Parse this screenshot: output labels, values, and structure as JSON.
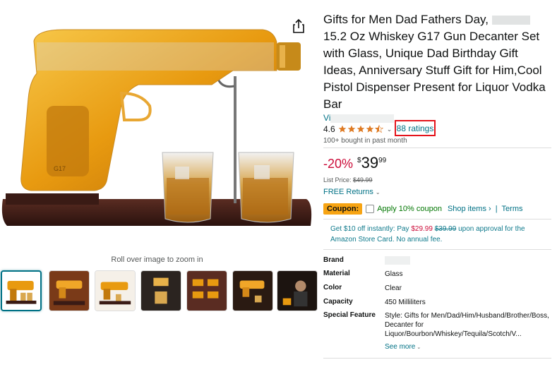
{
  "product": {
    "title": "Gifts for Men Dad Fathers Day, 15.2 Oz Whiskey G17 Gun Decanter Set with Glass, Unique Dad Birthday Gift Ideas, Anniversary Stuff Gift for Him,Cool Pistol Dispenser Present for Liquor Vodka Bar",
    "title_part1": "Gifts for Men Dad Fathers Day,",
    "title_part2": "15.2 Oz Whiskey G17 Gun Decanter Set with Glass, Unique Dad Birthday Gift Ideas, Anniversary Stuff Gift for Him,Cool Pistol Dispenser Present for Liquor Vodka Bar",
    "brand_prefix": "Vi"
  },
  "rating": {
    "value": "4.6",
    "stars": 4.5,
    "ratings_text": "88 ratings",
    "bought_text": "100+ bought in past month"
  },
  "price": {
    "discount": "-20%",
    "currency": "$",
    "whole": "39",
    "fraction": "99",
    "list_price_label": "List Price:",
    "list_price": "$49.99"
  },
  "returns": {
    "label": "FREE Returns",
    "chevron": "⌄"
  },
  "coupon": {
    "badge": "Coupon:",
    "label": "Apply 10% coupon",
    "shop_items": "Shop items ›",
    "separator": "|",
    "terms": "Terms"
  },
  "card_offer": {
    "text1": "Get $10 off instantly: Pay ",
    "pay_price": "$29.99",
    "space": " ",
    "original": "$39.99",
    "text2": " upon approval for the",
    "text3": "Amazon Store Card. No annual fee."
  },
  "gallery": {
    "roll_over": "Roll over image to zoom in",
    "thumbs": 7
  },
  "specs": {
    "rows": [
      {
        "key": "Brand",
        "value": ""
      },
      {
        "key": "Material",
        "value": "Glass"
      },
      {
        "key": "Color",
        "value": "Clear"
      },
      {
        "key": "Capacity",
        "value": "450 Milliliters"
      },
      {
        "key": "Special Feature",
        "value": "Style: Gifts for Men/Dad/Him/Husband/Brother/Boss, Decanter for Liquor/Bourbon/Whiskey/Tequila/Scotch/V..."
      }
    ],
    "see_more": "See more"
  },
  "colors": {
    "link": "#007185",
    "discount": "#cc0c39",
    "coupon_badge": "#f7a413",
    "coupon_green": "#007600",
    "highlight_box": "#e4141b",
    "star": "#de7921"
  },
  "icons": {
    "share": "share-icon",
    "star": "star-icon",
    "chevron": "chevron-down-icon"
  }
}
